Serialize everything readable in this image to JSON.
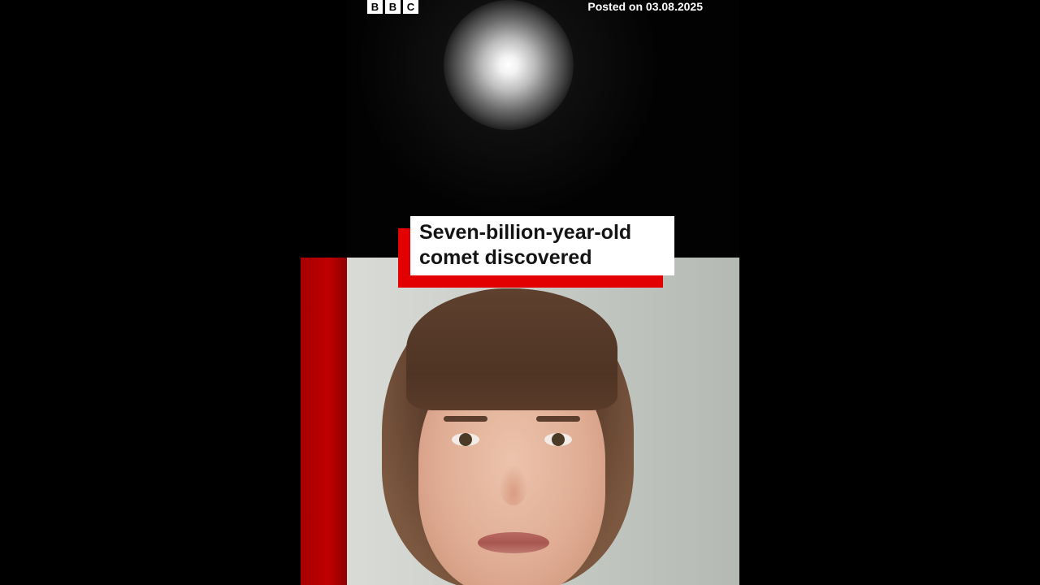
{
  "brand": {
    "logo_letters": [
      "B",
      "B",
      "C"
    ]
  },
  "posted_text": "Posted on 03.08.2025",
  "headline": {
    "line1": "Seven-billion-year-old",
    "line2": "comet discovered"
  },
  "colors": {
    "accent_red": "#e20000",
    "background": "#000000",
    "headline_box": "#ffffff"
  }
}
